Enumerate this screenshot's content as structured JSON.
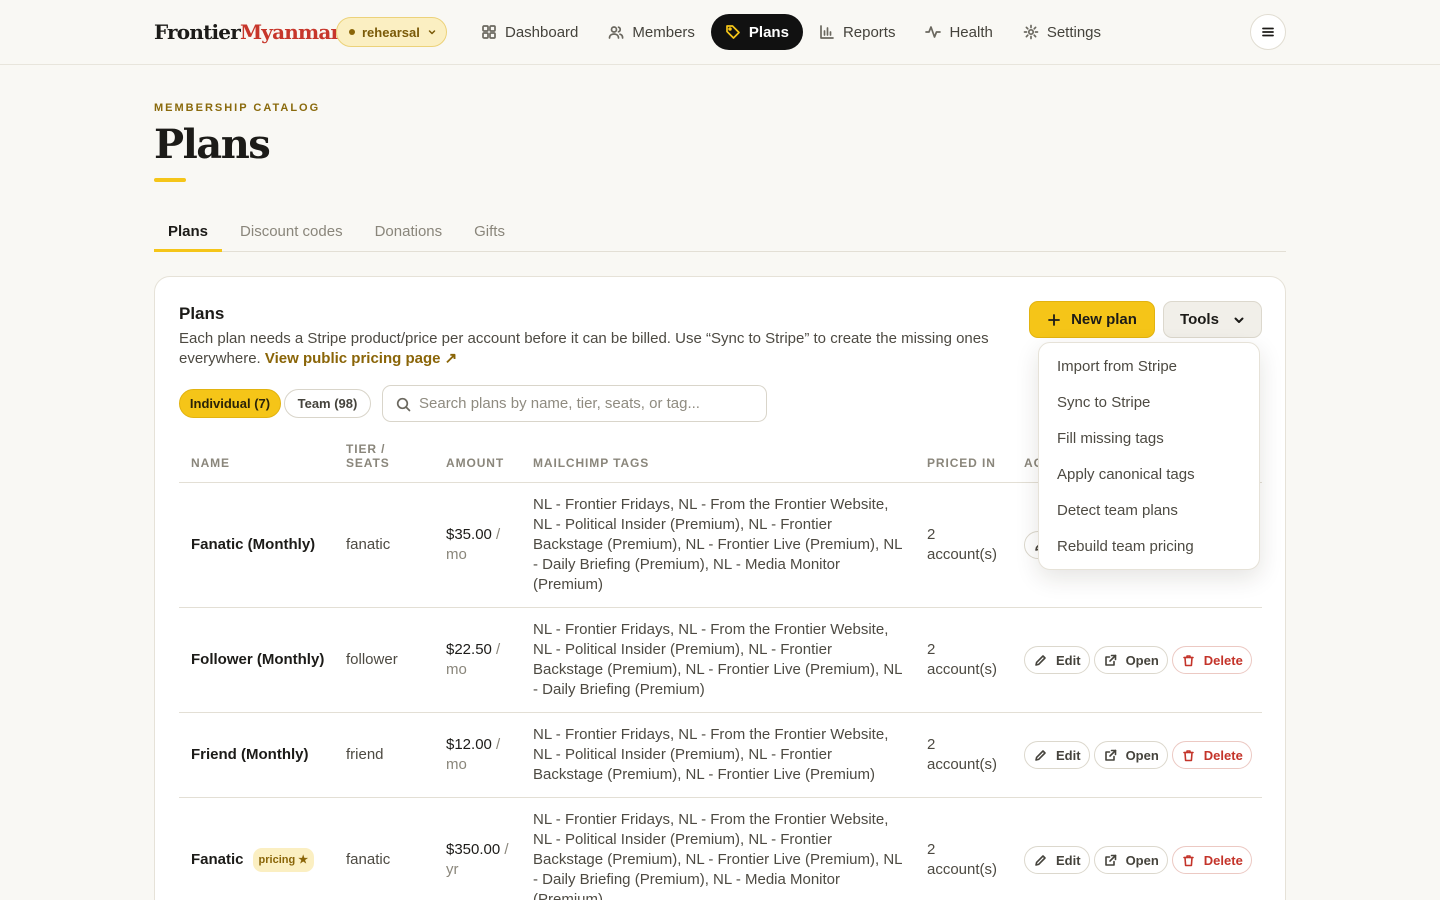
{
  "brand": {
    "part1": "Frontier",
    "part2": "Myanmar"
  },
  "env": {
    "label": "rehearsal"
  },
  "nav": [
    {
      "label": "Dashboard",
      "icon": "grid-icon"
    },
    {
      "label": "Members",
      "icon": "users-icon"
    },
    {
      "label": "Plans",
      "icon": "tag-icon",
      "active": true
    },
    {
      "label": "Reports",
      "icon": "bar-chart-icon"
    },
    {
      "label": "Health",
      "icon": "activity-icon"
    },
    {
      "label": "Settings",
      "icon": "gear-icon"
    }
  ],
  "page": {
    "eyebrow": "MEMBERSHIP CATALOG",
    "title": "Plans"
  },
  "tabs": [
    "Plans",
    "Discount codes",
    "Donations",
    "Gifts"
  ],
  "card": {
    "title": "Plans",
    "description": "Each plan needs a Stripe product/price per account before it can be billed. Use “Sync to Stripe” to create the missing ones everywhere.",
    "link": "View public pricing page ↗",
    "new_plan_label": "New plan",
    "tools_label": "Tools"
  },
  "filters": {
    "individual": "Individual (7)",
    "team": "Team (98)"
  },
  "search": {
    "placeholder": "Search plans by name, tier, seats, or tag...",
    "value": ""
  },
  "table": {
    "headers": {
      "name": "NAME",
      "tier": "TIER /\nSEATS",
      "amount": "AMOUNT",
      "tags": "MAILCHIMP TAGS",
      "priced": "PRICED IN",
      "actions": "ACTIONS"
    },
    "rows": [
      {
        "name": "Fanatic (Monthly)",
        "tier": "fanatic",
        "amount": "$35.00",
        "per": " / mo",
        "tags": "NL - Frontier Fridays, NL - From the Frontier Website, NL - Political Insider (Premium), NL - Frontier Backstage (Premium), NL - Frontier Live (Premium), NL - Daily Briefing (Premium), NL - Media Monitor (Premium)",
        "priced": "2 account(s)"
      },
      {
        "name": "Follower (Monthly)",
        "tier": "follower",
        "amount": "$22.50",
        "per": " / mo",
        "tags": "NL - Frontier Fridays, NL - From the Frontier Website, NL - Political Insider (Premium), NL - Frontier Backstage (Premium), NL - Frontier Live (Premium), NL - Daily Briefing (Premium)",
        "priced": "2 account(s)"
      },
      {
        "name": "Friend (Monthly)",
        "tier": "friend",
        "amount": "$12.00",
        "per": " / mo",
        "tags": "NL - Frontier Fridays, NL - From the Frontier Website, NL - Political Insider (Premium), NL - Frontier Backstage (Premium), NL - Frontier Live (Premium)",
        "priced": "2 account(s)"
      },
      {
        "name": "Fanatic",
        "badge": "pricing ★",
        "tier": "fanatic",
        "amount": "$350.00",
        "per": " / yr",
        "tags": "NL - Frontier Fridays, NL - From the Frontier Website, NL - Political Insider (Premium), NL - Frontier Backstage (Premium), NL - Frontier Live (Premium), NL - Daily Briefing (Premium), NL - Media Monitor (Premium)",
        "priced": "2 account(s)"
      }
    ],
    "actions": {
      "edit": "Edit",
      "open": "Open",
      "delete": "Delete"
    }
  },
  "tools_menu": [
    "Import from Stripe",
    "Sync to Stripe",
    "Fill missing tags",
    "Apply canonical tags",
    "Detect team plans",
    "Rebuild team pricing"
  ],
  "colors": {
    "accent": "#f5c518",
    "brand_red": "#c7362b",
    "danger": "#c4342a",
    "background": "#f9f8f4"
  }
}
